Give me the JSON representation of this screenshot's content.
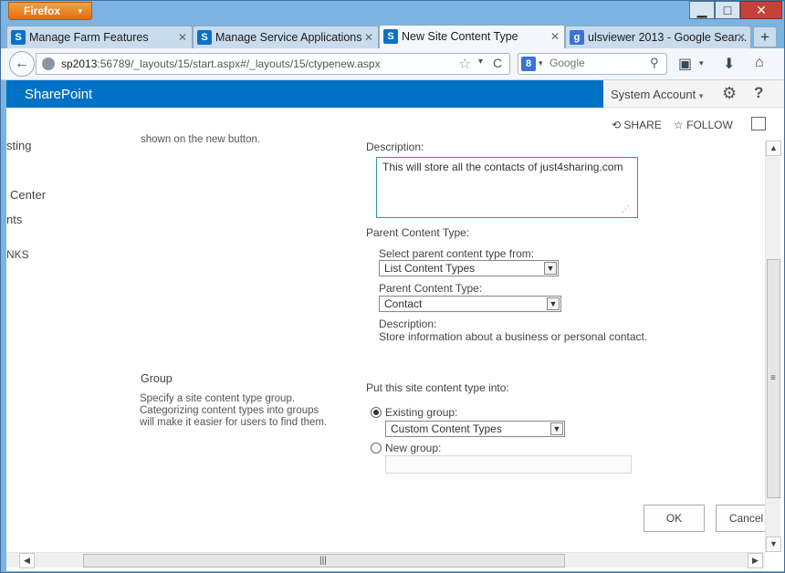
{
  "browser": {
    "menu_label": "Firefox",
    "menu_caret": "▾",
    "window_controls": {
      "minimize": "▁",
      "maximize": "□",
      "close": "✕"
    },
    "tabs": [
      {
        "label": "Manage Farm Features",
        "icon": "sharepoint-icon",
        "active": false
      },
      {
        "label": "Manage Service Applications",
        "icon": "sharepoint-icon",
        "active": false
      },
      {
        "label": "New Site Content Type",
        "icon": "sharepoint-icon",
        "active": true
      },
      {
        "label": "ulsviewer 2013 - Google Sear...",
        "icon": "google-icon",
        "active": false
      }
    ],
    "tab_close": "✕",
    "new_tab": "+",
    "url": {
      "host": "sp2013",
      "rest": ":56789/_layouts/15/start.aspx#/_layouts/15/ctypenew.aspx"
    },
    "search": {
      "engine_glyph": "8",
      "placeholder": "Google"
    },
    "icons": {
      "back": "←",
      "star": "☆",
      "reload": "C",
      "search_go": "⚲",
      "bookmarks": "▣",
      "download": "⬇",
      "home": "⌂",
      "caret": "▾"
    }
  },
  "suite": {
    "brand": "SharePoint",
    "account": "System Account",
    "account_caret": "▾",
    "settings_glyph": "⚙",
    "help_glyph": "?"
  },
  "actions": {
    "share": "SHARE",
    "follow": "FOLLOW",
    "share_glyph": "⟲",
    "follow_glyph": "☆"
  },
  "left_nav": [
    "sting",
    "Center",
    "nts",
    "NKS"
  ],
  "form": {
    "name_help_fragment": "shown on the new button.",
    "description_label": "Description:",
    "description_value": "This will store all the contacts of just4sharing.com",
    "parent_section_label": "Parent Content Type:",
    "select_from_label": "Select parent content type from:",
    "select_from_value": "List Content Types",
    "parent_label": "Parent Content Type:",
    "parent_value": "Contact",
    "parent_description_label": "Description:",
    "parent_description_value": "Store information about a business or personal contact.",
    "group_title": "Group",
    "group_help": "Specify a site content type group. Categorizing content types into groups will make it easier for users to find them.",
    "put_into_label": "Put this site content type into:",
    "existing_group_label": "Existing group:",
    "existing_group_value": "Custom Content Types",
    "new_group_label": "New group:",
    "new_group_value": "",
    "ok": "OK",
    "cancel": "Cancel"
  },
  "scroll": {
    "up": "▲",
    "down": "▼",
    "left": "◀",
    "right": "▶",
    "grip_v": "≡",
    "grip_h": "|||"
  }
}
